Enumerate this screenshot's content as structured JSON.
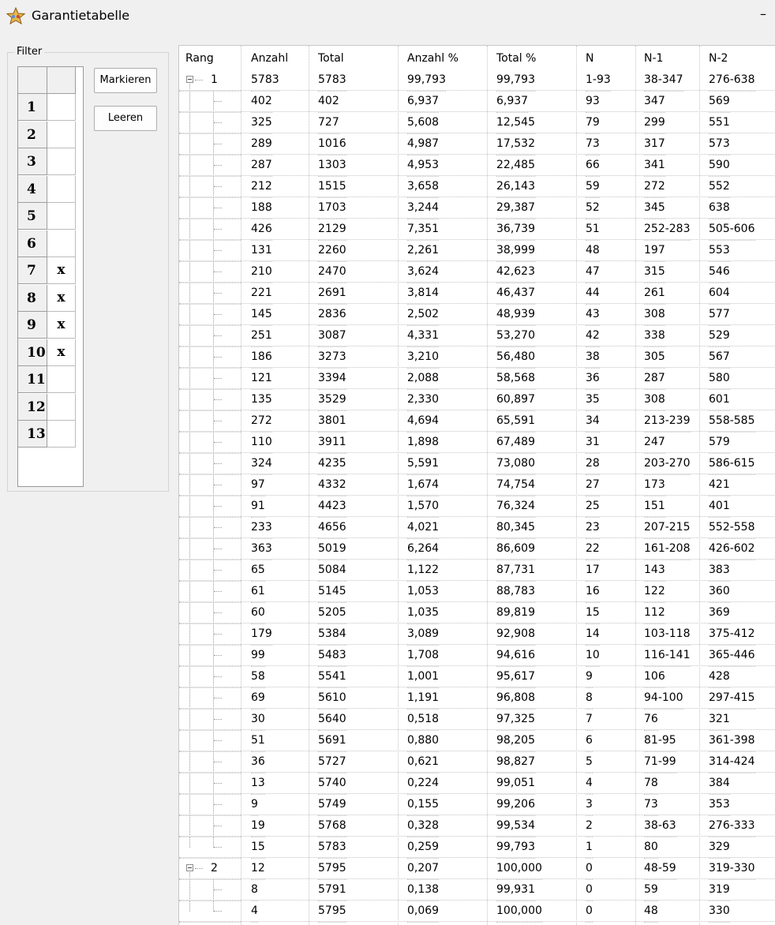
{
  "window": {
    "title": "Garantietabelle",
    "minimize_glyph": "–",
    "icon": "star-app-icon"
  },
  "filter": {
    "legend": "Filter",
    "rows": [
      {
        "num": "1",
        "val": ""
      },
      {
        "num": "2",
        "val": ""
      },
      {
        "num": "3",
        "val": ""
      },
      {
        "num": "4",
        "val": ""
      },
      {
        "num": "5",
        "val": ""
      },
      {
        "num": "6",
        "val": ""
      },
      {
        "num": "7",
        "val": "x"
      },
      {
        "num": "8",
        "val": "x"
      },
      {
        "num": "9",
        "val": "x"
      },
      {
        "num": "10",
        "val": "x"
      },
      {
        "num": "11",
        "val": ""
      },
      {
        "num": "12",
        "val": ""
      },
      {
        "num": "13",
        "val": ""
      }
    ],
    "mark_button": "Markieren",
    "clear_button": "Leeren"
  },
  "table": {
    "columns": [
      "Rang",
      "Anzahl",
      "Total",
      "Anzahl %",
      "Total %",
      "N",
      "N-1",
      "N-2"
    ],
    "rows": [
      {
        "level": 0,
        "rang": "1",
        "cells": [
          "5783",
          "5783",
          "99,793",
          "99,793",
          "1-93",
          "38-347",
          "276-638"
        ]
      },
      {
        "level": 1,
        "rang": "",
        "cells": [
          "402",
          "402",
          "6,937",
          "6,937",
          "93",
          "347",
          "569"
        ]
      },
      {
        "level": 1,
        "rang": "",
        "cells": [
          "325",
          "727",
          "5,608",
          "12,545",
          "79",
          "299",
          "551"
        ]
      },
      {
        "level": 1,
        "rang": "",
        "cells": [
          "289",
          "1016",
          "4,987",
          "17,532",
          "73",
          "317",
          "573"
        ]
      },
      {
        "level": 1,
        "rang": "",
        "cells": [
          "287",
          "1303",
          "4,953",
          "22,485",
          "66",
          "341",
          "590"
        ]
      },
      {
        "level": 1,
        "rang": "",
        "cells": [
          "212",
          "1515",
          "3,658",
          "26,143",
          "59",
          "272",
          "552"
        ]
      },
      {
        "level": 1,
        "rang": "",
        "cells": [
          "188",
          "1703",
          "3,244",
          "29,387",
          "52",
          "345",
          "638"
        ]
      },
      {
        "level": 1,
        "rang": "",
        "cells": [
          "426",
          "2129",
          "7,351",
          "36,739",
          "51",
          "252-283",
          "505-606"
        ]
      },
      {
        "level": 1,
        "rang": "",
        "cells": [
          "131",
          "2260",
          "2,261",
          "38,999",
          "48",
          "197",
          "553"
        ]
      },
      {
        "level": 1,
        "rang": "",
        "cells": [
          "210",
          "2470",
          "3,624",
          "42,623",
          "47",
          "315",
          "546"
        ]
      },
      {
        "level": 1,
        "rang": "",
        "cells": [
          "221",
          "2691",
          "3,814",
          "46,437",
          "44",
          "261",
          "604"
        ]
      },
      {
        "level": 1,
        "rang": "",
        "cells": [
          "145",
          "2836",
          "2,502",
          "48,939",
          "43",
          "308",
          "577"
        ]
      },
      {
        "level": 1,
        "rang": "",
        "cells": [
          "251",
          "3087",
          "4,331",
          "53,270",
          "42",
          "338",
          "529"
        ]
      },
      {
        "level": 1,
        "rang": "",
        "cells": [
          "186",
          "3273",
          "3,210",
          "56,480",
          "38",
          "305",
          "567"
        ]
      },
      {
        "level": 1,
        "rang": "",
        "cells": [
          "121",
          "3394",
          "2,088",
          "58,568",
          "36",
          "287",
          "580"
        ]
      },
      {
        "level": 1,
        "rang": "",
        "cells": [
          "135",
          "3529",
          "2,330",
          "60,897",
          "35",
          "308",
          "601"
        ]
      },
      {
        "level": 1,
        "rang": "",
        "cells": [
          "272",
          "3801",
          "4,694",
          "65,591",
          "34",
          "213-239",
          "558-585"
        ]
      },
      {
        "level": 1,
        "rang": "",
        "cells": [
          "110",
          "3911",
          "1,898",
          "67,489",
          "31",
          "247",
          "579"
        ]
      },
      {
        "level": 1,
        "rang": "",
        "cells": [
          "324",
          "4235",
          "5,591",
          "73,080",
          "28",
          "203-270",
          "586-615"
        ]
      },
      {
        "level": 1,
        "rang": "",
        "cells": [
          "97",
          "4332",
          "1,674",
          "74,754",
          "27",
          "173",
          "421"
        ]
      },
      {
        "level": 1,
        "rang": "",
        "cells": [
          "91",
          "4423",
          "1,570",
          "76,324",
          "25",
          "151",
          "401"
        ]
      },
      {
        "level": 1,
        "rang": "",
        "cells": [
          "233",
          "4656",
          "4,021",
          "80,345",
          "23",
          "207-215",
          "552-558"
        ]
      },
      {
        "level": 1,
        "rang": "",
        "cells": [
          "363",
          "5019",
          "6,264",
          "86,609",
          "22",
          "161-208",
          "426-602"
        ]
      },
      {
        "level": 1,
        "rang": "",
        "cells": [
          "65",
          "5084",
          "1,122",
          "87,731",
          "17",
          "143",
          "383"
        ]
      },
      {
        "level": 1,
        "rang": "",
        "cells": [
          "61",
          "5145",
          "1,053",
          "88,783",
          "16",
          "122",
          "360"
        ]
      },
      {
        "level": 1,
        "rang": "",
        "cells": [
          "60",
          "5205",
          "1,035",
          "89,819",
          "15",
          "112",
          "369"
        ]
      },
      {
        "level": 1,
        "rang": "",
        "cells": [
          "179",
          "5384",
          "3,089",
          "92,908",
          "14",
          "103-118",
          "375-412"
        ]
      },
      {
        "level": 1,
        "rang": "",
        "cells": [
          "99",
          "5483",
          "1,708",
          "94,616",
          "10",
          "116-141",
          "365-446"
        ]
      },
      {
        "level": 1,
        "rang": "",
        "cells": [
          "58",
          "5541",
          "1,001",
          "95,617",
          "9",
          "106",
          "428"
        ]
      },
      {
        "level": 1,
        "rang": "",
        "cells": [
          "69",
          "5610",
          "1,191",
          "96,808",
          "8",
          "94-100",
          "297-415"
        ]
      },
      {
        "level": 1,
        "rang": "",
        "cells": [
          "30",
          "5640",
          "0,518",
          "97,325",
          "7",
          "76",
          "321"
        ]
      },
      {
        "level": 1,
        "rang": "",
        "cells": [
          "51",
          "5691",
          "0,880",
          "98,205",
          "6",
          "81-95",
          "361-398"
        ]
      },
      {
        "level": 1,
        "rang": "",
        "cells": [
          "36",
          "5727",
          "0,621",
          "98,827",
          "5",
          "71-99",
          "314-424"
        ]
      },
      {
        "level": 1,
        "rang": "",
        "cells": [
          "13",
          "5740",
          "0,224",
          "99,051",
          "4",
          "78",
          "384"
        ]
      },
      {
        "level": 1,
        "rang": "",
        "cells": [
          "9",
          "5749",
          "0,155",
          "99,206",
          "3",
          "73",
          "353"
        ]
      },
      {
        "level": 1,
        "rang": "",
        "cells": [
          "19",
          "5768",
          "0,328",
          "99,534",
          "2",
          "38-63",
          "276-333"
        ]
      },
      {
        "level": 1,
        "rang": "",
        "last": true,
        "cells": [
          "15",
          "5783",
          "0,259",
          "99,793",
          "1",
          "80",
          "329"
        ]
      },
      {
        "level": 0,
        "rang": "2",
        "cells": [
          "12",
          "5795",
          "0,207",
          "100,000",
          "0",
          "48-59",
          "319-330"
        ]
      },
      {
        "level": 1,
        "rang": "",
        "cells": [
          "8",
          "5791",
          "0,138",
          "99,931",
          "0",
          "59",
          "319"
        ]
      },
      {
        "level": 1,
        "rang": "",
        "last": true,
        "cells": [
          "4",
          "5795",
          "0,069",
          "100,000",
          "0",
          "48",
          "330"
        ]
      }
    ]
  }
}
